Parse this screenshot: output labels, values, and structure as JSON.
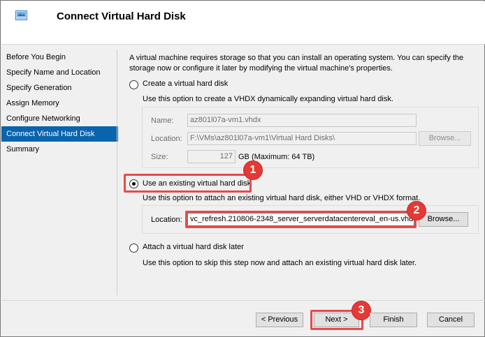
{
  "window": {
    "title": "Connect Virtual Hard Disk"
  },
  "nav": {
    "items": [
      {
        "label": "Before You Begin"
      },
      {
        "label": "Specify Name and Location"
      },
      {
        "label": "Specify Generation"
      },
      {
        "label": "Assign Memory"
      },
      {
        "label": "Configure Networking"
      },
      {
        "label": "Connect Virtual Hard Disk"
      },
      {
        "label": "Summary"
      }
    ],
    "selected": "Connect Virtual Hard Disk"
  },
  "intro": "A virtual machine requires storage so that you can install an operating system. You can specify the storage now or configure it later by modifying the virtual machine's properties.",
  "options": {
    "create": {
      "label": "Create a virtual hard disk",
      "description": "Use this option to create a VHDX dynamically expanding virtual hard disk.",
      "name_label": "Name:",
      "name_value": "az801l07a-vm1.vhdx",
      "location_label": "Location:",
      "location_value": "F:\\VMs\\az801l07a-vm1\\Virtual Hard Disks\\",
      "browse_label": "Browse...",
      "size_label": "Size:",
      "size_value": "127",
      "size_unit": "GB (Maximum: 64 TB)"
    },
    "existing": {
      "label": "Use an existing virtual hard disk",
      "description": "Use this option to attach an existing virtual hard disk, either VHD or VHDX format.",
      "location_label": "Location:",
      "location_value": "vc_refresh.210806-2348_server_serverdatacentereval_en-us.vhd",
      "browse_label": "Browse..."
    },
    "later": {
      "label": "Attach a virtual hard disk later",
      "description": "Use this option to skip this step now and attach an existing virtual hard disk later."
    },
    "selected": "existing"
  },
  "buttons": {
    "previous": "< Previous",
    "next": "Next >",
    "finish": "Finish",
    "cancel": "Cancel"
  },
  "callouts": [
    "1",
    "2",
    "3"
  ],
  "colors": {
    "selection": "#0a64ad",
    "callout": "#e53935"
  }
}
